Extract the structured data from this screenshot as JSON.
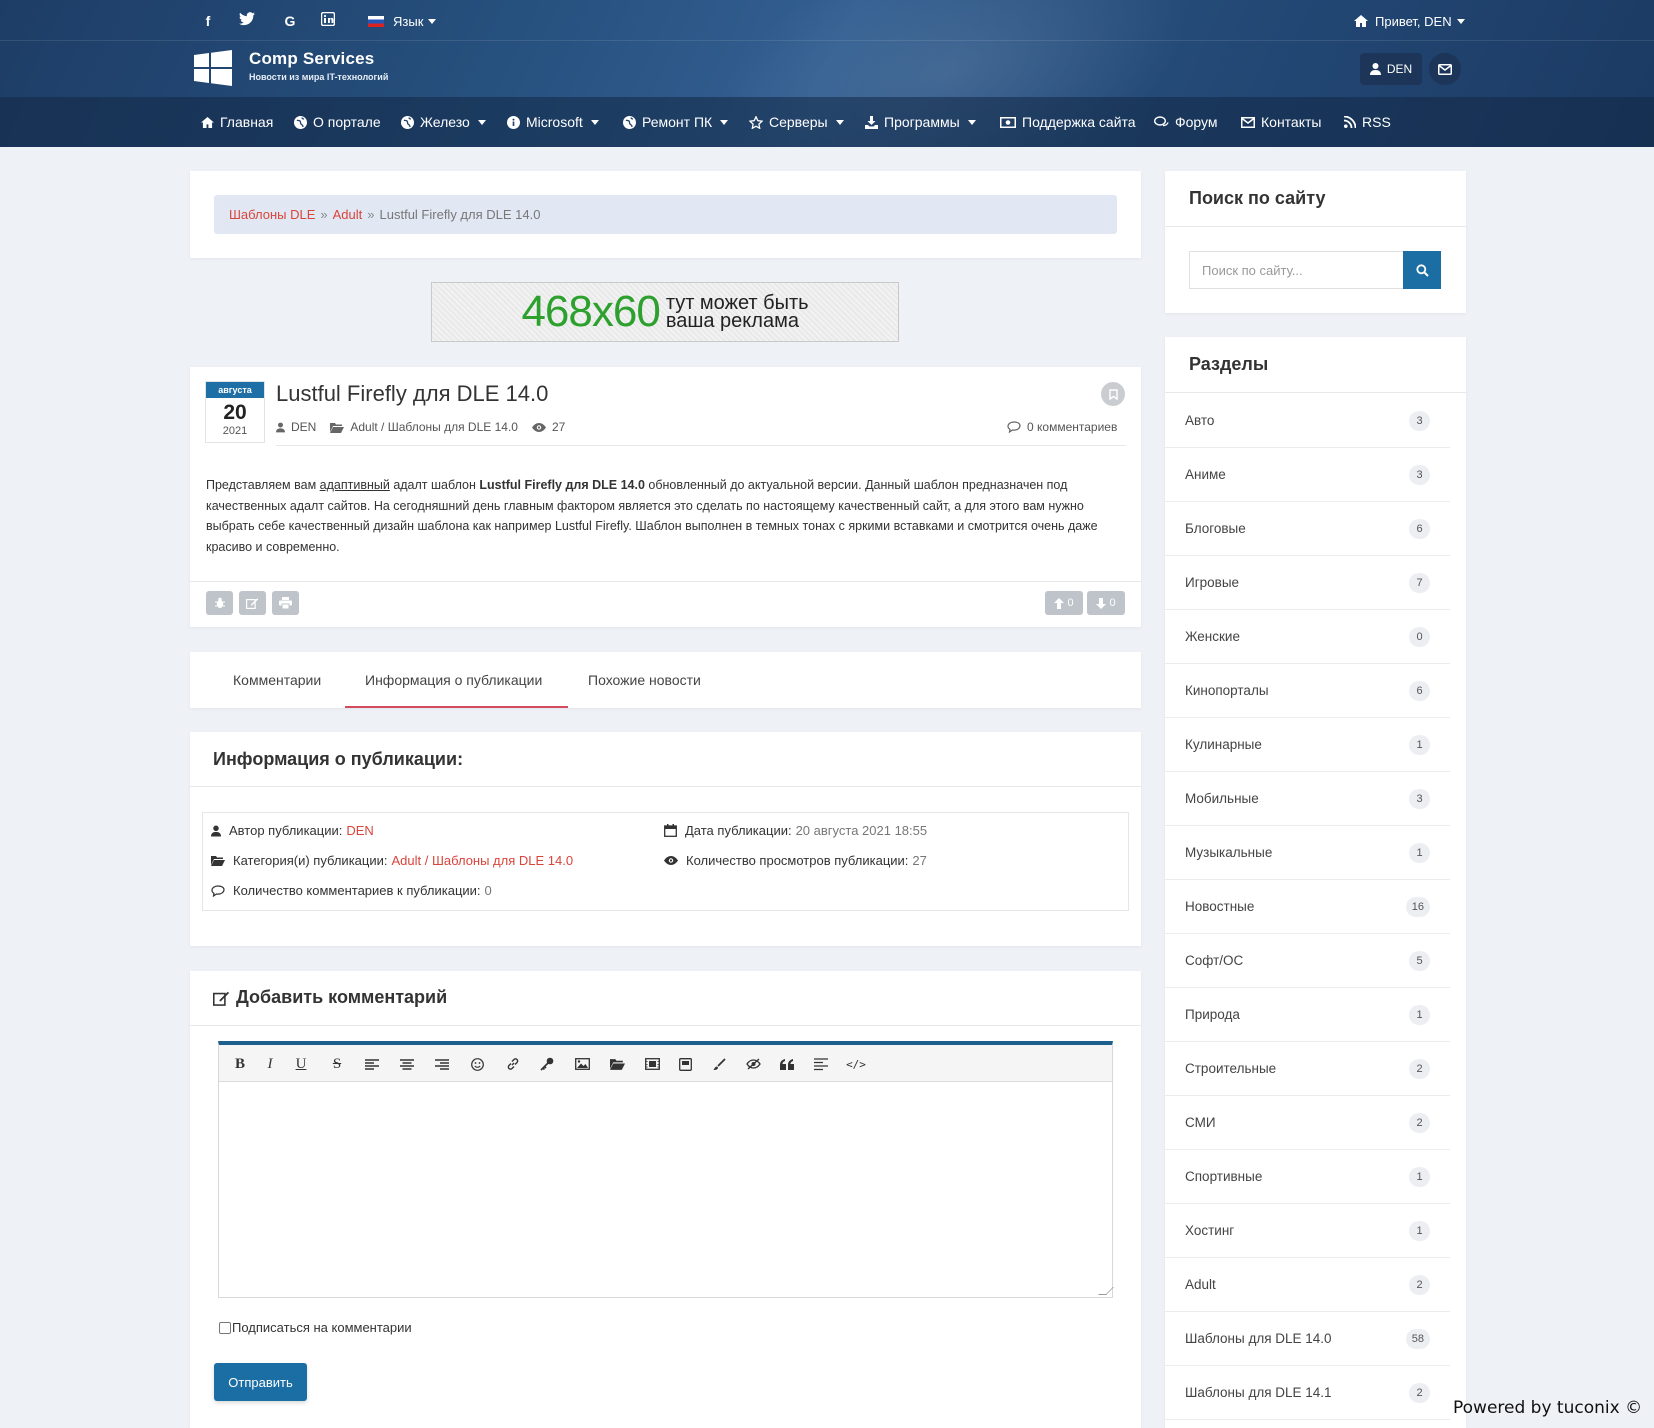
{
  "topbar": {
    "social": [
      "f",
      "t",
      "G",
      "in"
    ],
    "lang_label": "Язык",
    "greeting": "Привет, DEN"
  },
  "brand": {
    "title": "Comp Services",
    "subtitle": "Новости из мира IT-технологий"
  },
  "user": {
    "name": "DEN"
  },
  "nav": [
    {
      "label": "Главная",
      "icon": "home-icon",
      "dropdown": false
    },
    {
      "label": "О портале",
      "icon": "globe-icon",
      "dropdown": false
    },
    {
      "label": "Железо",
      "icon": "globe-icon",
      "dropdown": true
    },
    {
      "label": "Microsoft",
      "icon": "info-icon",
      "dropdown": true
    },
    {
      "label": "Ремонт ПК",
      "icon": "globe-icon",
      "dropdown": true
    },
    {
      "label": "Серверы",
      "icon": "star-icon",
      "dropdown": true
    },
    {
      "label": "Программы",
      "icon": "download-icon",
      "dropdown": true
    },
    {
      "label": "Поддержка сайта",
      "icon": "money-icon",
      "dropdown": false
    },
    {
      "label": "Форум",
      "icon": "comments-icon",
      "dropdown": false
    },
    {
      "label": "Контакты",
      "icon": "mail-icon",
      "dropdown": false
    },
    {
      "label": "RSS",
      "icon": "rss-icon",
      "dropdown": false
    }
  ],
  "breadcrumb": {
    "items": [
      "Шаблоны DLE",
      "Adult"
    ],
    "current": "Lustful Firefly для DLE 14.0",
    "separator": "»"
  },
  "ad": {
    "size": "468x60",
    "line1": "тут может быть",
    "line2": "ваша реклама"
  },
  "article": {
    "date": {
      "month": "августа",
      "day": "20",
      "year": "2021"
    },
    "title": "Lustful Firefly для DLE 14.0",
    "author": "DEN",
    "category": "Adult / Шаблоны для DLE 14.0",
    "views": "27",
    "comments_label": "0 комментариев",
    "text": {
      "p1": "Представляем вам ",
      "p1_link": "адаптивный",
      "p2": " адалт шаблон ",
      "p2_bold": "Lustful Firefly для DLE 14.0",
      "p3": " обновленный до актуальной версии. Данный шаблон предназначен под качественных адалт сайтов. На сегодняшний день главным фактором является это сделать по настоящему качественный сайт, а для этого вам нужно выбрать себе качественный дизайн шаблона как например Lustful Firefly. Шаблон выполнен в темных тонах с яркими вставками и смотрится очень даже красиво и современно."
    },
    "rating_up": "0",
    "rating_down": "0"
  },
  "tabs": [
    "Комментарии",
    "Информация о публикации",
    "Похожие новости"
  ],
  "active_tab": "Информация о публикации",
  "info": {
    "title": "Информация о публикации:",
    "author_label": "Автор публикации:",
    "author": "DEN",
    "date_label": "Дата публикации:",
    "date": "20 августа 2021 18:55",
    "category_label": "Категория(и) публикации:",
    "category": "Adult / Шаблоны для DLE 14.0",
    "views_label": "Количество просмотров публикации:",
    "views": "27",
    "comments_label": "Количество комментариев к публикации:",
    "comments": "0"
  },
  "comment_form": {
    "title": "Добавить комментарий",
    "subscribe_label": "Подписаться на комментарии",
    "submit_label": "Отправить"
  },
  "sidebar": {
    "search_title": "Поиск по сайту",
    "search_placeholder": "Поиск по сайту...",
    "sections_title": "Разделы",
    "categories": [
      {
        "name": "Авто",
        "count": "3"
      },
      {
        "name": "Аниме",
        "count": "3"
      },
      {
        "name": "Блоговые",
        "count": "6"
      },
      {
        "name": "Игровые",
        "count": "7"
      },
      {
        "name": "Женские",
        "count": "0"
      },
      {
        "name": "Кинопорталы",
        "count": "6"
      },
      {
        "name": "Кулинарные",
        "count": "1"
      },
      {
        "name": "Мобильные",
        "count": "3"
      },
      {
        "name": "Музыкальные",
        "count": "1"
      },
      {
        "name": "Новостные",
        "count": "16"
      },
      {
        "name": "Софт/ОС",
        "count": "5"
      },
      {
        "name": "Природа",
        "count": "1"
      },
      {
        "name": "Строительные",
        "count": "2"
      },
      {
        "name": "СМИ",
        "count": "2"
      },
      {
        "name": "Спортивные",
        "count": "1"
      },
      {
        "name": "Хостинг",
        "count": "1"
      },
      {
        "name": "Adult",
        "count": "2"
      },
      {
        "name": "Шаблоны для DLE 14.0",
        "count": "58"
      },
      {
        "name": "Шаблоны для DLE 14.1",
        "count": "2"
      }
    ]
  },
  "footer_note": "Powered by tuconix ©",
  "colors": {
    "header": "#244a77",
    "accent_blue": "#1b6ea4",
    "link_red": "#d9443b",
    "tab_underline": "#d14c5e",
    "ad_green": "#2ea02e"
  }
}
